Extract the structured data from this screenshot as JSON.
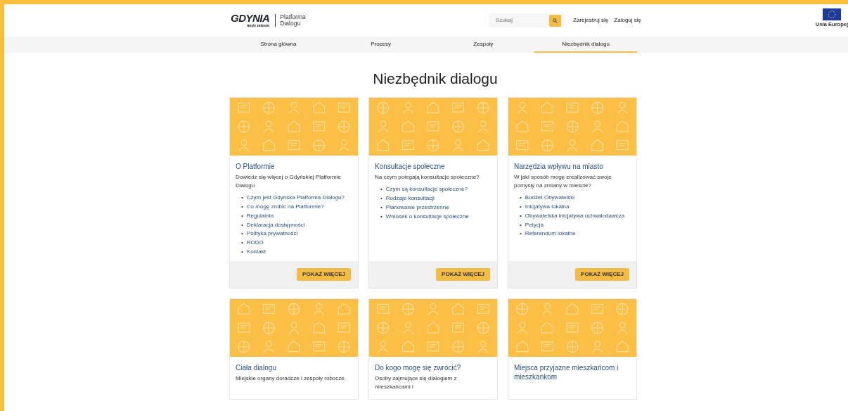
{
  "header": {
    "logo": {
      "wordmark": "GDYNIA",
      "tagline": "moje miasto",
      "site_name": [
        "Platforma",
        "Dialogu"
      ]
    },
    "search": {
      "placeholder": "Szukaj"
    },
    "links": [
      "Zarejestruj się",
      "Zaloguj się"
    ],
    "eu_label": "Unia Europej"
  },
  "nav": [
    {
      "label": "Strona główna",
      "selected": false
    },
    {
      "label": "Procesy",
      "selected": false
    },
    {
      "label": "Zespoły",
      "selected": false
    },
    {
      "label": "Niezbędnik dialogu",
      "selected": true
    }
  ],
  "page_title": "Niezbędnik dialogu",
  "cards": [
    {
      "title": "O Platformie",
      "bullet": "•",
      "description": "Dowiedz się więcej o Gdyńskiej Platformie Dialogu",
      "links": [
        "Czym jest Gdyńska Platforma Dialogu?",
        "Co mogę zrobić na Platformie?",
        "Regulamin",
        "Deklaracja dostępności",
        "Polityka prywatności",
        "RODO",
        "Kontakt"
      ],
      "button": "POKAŻ WIĘCEJ"
    },
    {
      "title": "Konsultacje społeczne",
      "bullet": "•",
      "description": "Na czym polegają konsultacje społeczne?",
      "links": [
        "Czym są konsultacje społeczne?",
        "Rodzaje konsultacji",
        "Planowanie przestrzenne",
        "Wniosek o konsultacje społeczne"
      ],
      "button": "POKAŻ WIĘCEJ"
    },
    {
      "title": "Narzędzia wpływu na miasto",
      "bullet": "•",
      "description": "W jaki sposób mogę zrealizować swoje pomysły na zmiany w mieście?",
      "links": [
        "Budżet Obywatelski",
        "Inicjatywa lokalna",
        "Obywatelska inicjatywa uchwałodawcza",
        "Petycja",
        "Referendum lokalne"
      ],
      "button": "POKAŻ WIĘCEJ"
    },
    {
      "title": "Ciała dialogu",
      "description": "Miejskie organy doradcze i zespoły robocze"
    },
    {
      "title": "Do kogo mogę się zwrócić?",
      "description": "Osoby zajmujące się dialogiem z mieszkańcami i"
    },
    {
      "title": "Miejsca przyjazne mieszkańcom i mieszkankom"
    }
  ]
}
